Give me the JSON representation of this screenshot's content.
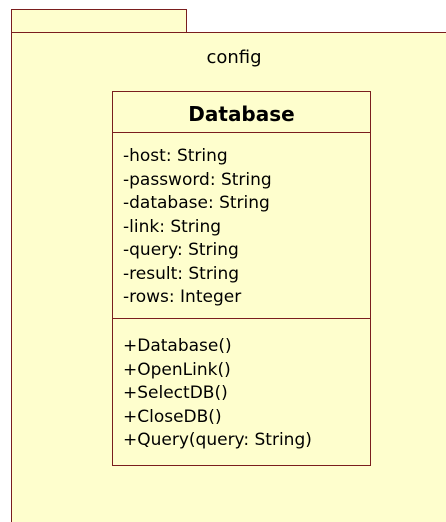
{
  "package": {
    "name": "config"
  },
  "class": {
    "name": "Database",
    "attributes": [
      "-host: String",
      "-password: String",
      "-database: String",
      "-link: String",
      "-query: String",
      "-result: String",
      "-rows: Integer"
    ],
    "operations": [
      "+Database()",
      "+OpenLink()",
      "+SelectDB()",
      "+CloseDB()",
      "+Query(query: String)"
    ]
  },
  "colors": {
    "fill": "#fefecd",
    "border": "#7a1e1e"
  }
}
